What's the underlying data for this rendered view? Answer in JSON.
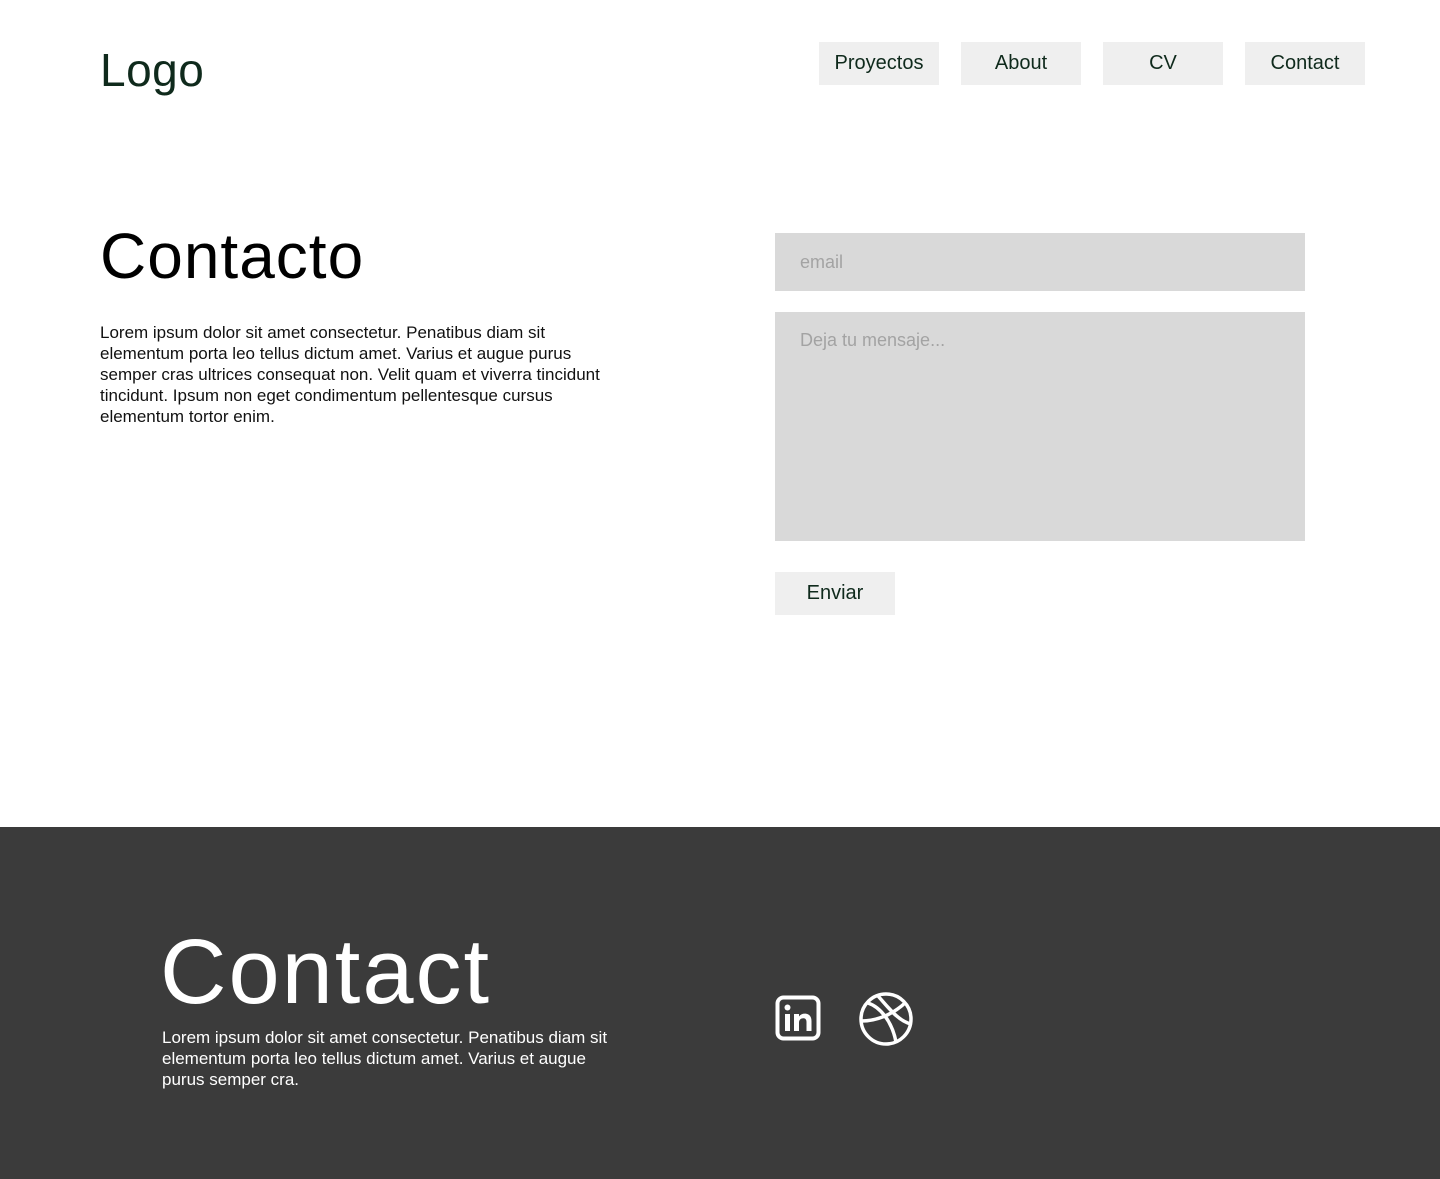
{
  "header": {
    "logo": "Logo",
    "nav": [
      {
        "label": "Proyectos"
      },
      {
        "label": "About"
      },
      {
        "label": "CV"
      },
      {
        "label": "Contact"
      }
    ]
  },
  "main": {
    "title": "Contacto",
    "intro": "Lorem ipsum dolor sit amet consectetur. Penatibus diam sit elementum porta leo tellus dictum amet. Varius et augue purus semper cras ultrices consequat non. Velit quam et viverra tincidunt tincidunt. Ipsum non eget condimentum pellentesque cursus elementum tortor enim.",
    "form": {
      "email_value": "",
      "email_placeholder": "email",
      "message_value": "",
      "message_placeholder": "Deja tu mensaje...",
      "submit_label": "Enviar"
    }
  },
  "footer": {
    "title": "Contact",
    "text": "Lorem ipsum dolor sit amet consectetur. Penatibus diam sit elementum porta leo tellus dictum amet. Varius et augue purus semper cra.",
    "social": [
      {
        "icon": "linkedin-icon"
      },
      {
        "icon": "dribbble-icon"
      }
    ]
  },
  "colors": {
    "brand_text": "#0f2a1c",
    "button_bg": "#efefef",
    "field_bg": "#d9d9d9",
    "footer_bg": "#3b3b3b",
    "footer_text": "#ffffff"
  }
}
